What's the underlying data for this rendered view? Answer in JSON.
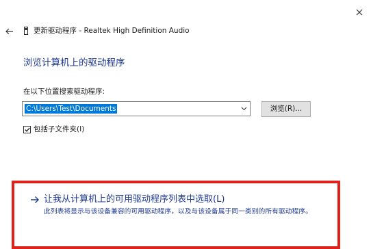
{
  "window": {
    "title": "更新驱动程序 - Realtek High Definition Audio",
    "close_icon": "close-icon",
    "back_icon": "back-arrow-icon",
    "device_icon": "device-icon"
  },
  "page": {
    "heading": "浏览计算机上的驱动程序",
    "search_label": "在以下位置搜索驱动程序:",
    "path_value": "C:\\Users\\Test\\Documents",
    "dropdown_icon": "chevron-down-icon",
    "browse_button": "浏览(R)...",
    "include_subfolders_label": "包括子文件夹(I)",
    "include_subfolders_checked": true
  },
  "pick_option": {
    "label": "让我从计算机上的可用驱动程序列表中选取(L)",
    "description": "此列表将显示与该设备兼容的可用驱动程序，以及与该设备属于同一类别的所有驱动程序。",
    "arrow_icon": "arrow-right-icon"
  },
  "colors": {
    "link_blue": "#1f3a93",
    "highlight_red": "#e0201b",
    "selection_blue": "#0078d7"
  }
}
